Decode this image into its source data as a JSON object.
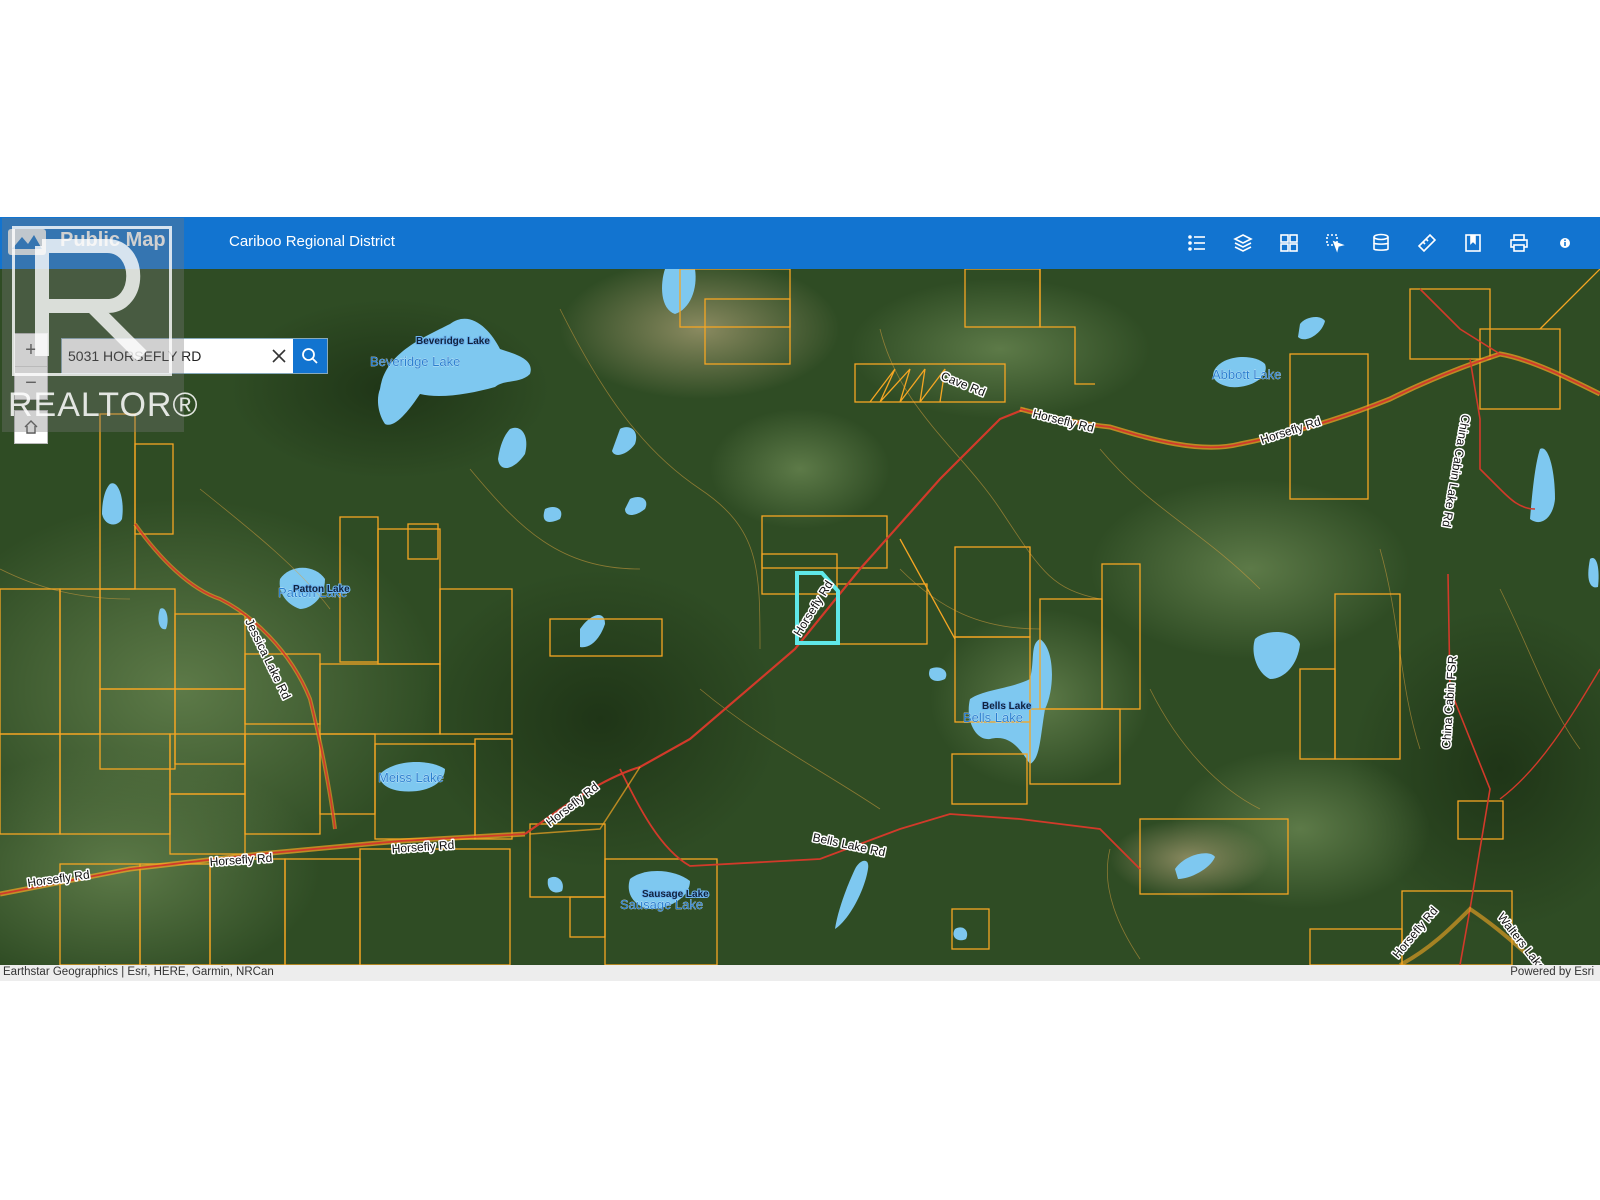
{
  "header": {
    "app_title": "Public Map",
    "district": "Cariboo Regional District"
  },
  "toolbar": [
    {
      "name": "legend-icon"
    },
    {
      "name": "layers-icon"
    },
    {
      "name": "basemap-gallery-icon"
    },
    {
      "name": "select-icon"
    },
    {
      "name": "query-icon"
    },
    {
      "name": "measure-icon"
    },
    {
      "name": "bookmark-icon"
    },
    {
      "name": "print-icon"
    },
    {
      "name": "info-icon"
    }
  ],
  "search": {
    "value": "5031 HORSEFLY RD"
  },
  "zoom": {
    "in_label": "+",
    "out_label": "−"
  },
  "attribution": {
    "left": "Earthstar Geographics | Esri, HERE, Garmin, NRCan",
    "right": "Powered by Esri"
  },
  "watermark": {
    "text": "REALTOR®"
  },
  "map": {
    "road_labels": {
      "cave_rd": "Cave Rd",
      "horsefly_rd_ne1": "Horsefly Rd",
      "horsefly_rd_ne2": "Horsefly Rd",
      "horsefly_rd_center": "Horsefly Rd",
      "horsefly_rd_sw": "Horsefly Rd",
      "horsefly_rd_s1": "Horsefly Rd",
      "horsefly_rd_s2": "Horsefly Rd",
      "horsefly_rd_w": "Horsefly Rd",
      "horsefly_rd_se": "Horsefly Rd",
      "jessica_lake_rd": "Jessica Lake Rd",
      "bells_lake_rd": "Bells Lake Rd",
      "china_cabin_lake_rd": "China Cabin Lake Rd",
      "china_cabin_fsr": "China Cabin FSR",
      "walters_lake": "Walters Lake"
    },
    "lake_labels": {
      "beveridge_lake": "Beveridge Lake",
      "beveridge_lake_tag": "Beveridge Lake",
      "abbott_lake": "Abbott Lake",
      "patton_lake": "Patton Lake",
      "patton_lake_tag": "Patton Lake",
      "meiss_lake": "Meiss Lake",
      "bells_lake": "Bells Lake",
      "bells_lake_tag": "Bells Lake",
      "sausage_lake": "Sausage Lake",
      "sausage_lake_tag": "Sausage Lake"
    },
    "colors": {
      "header": "#1274d0",
      "parcel": "#f5a623",
      "highway": "#d23a2a",
      "selected_parcel": "#5fe8e8",
      "lake": "#7ec8f0",
      "forest": "#2e4a22"
    }
  }
}
